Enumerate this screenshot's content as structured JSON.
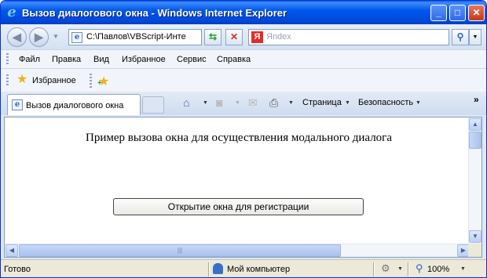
{
  "window": {
    "title": "Вызов диалогового окна - Windows Internet Explorer",
    "minimize_glyph": "_",
    "maximize_glyph": "□",
    "close_glyph": "✕"
  },
  "address_bar": {
    "url": "C:\\Павлов\\VBScript-Инте",
    "search_placeholder": "Яndex",
    "search_logo": "Я"
  },
  "menu": {
    "items": [
      "Файл",
      "Правка",
      "Вид",
      "Избранное",
      "Сервис",
      "Справка"
    ]
  },
  "favorites": {
    "label": "Избранное"
  },
  "tabs": {
    "active_label": "Вызов диалогового окна"
  },
  "command_bar": {
    "page_label": "Страница",
    "safety_label": "Безопасность",
    "overflow": "»"
  },
  "page": {
    "heading": "Пример вызова окна для осуществления модального диалога",
    "button_label": "Открытие окна для регистрации"
  },
  "status": {
    "text": "Готово",
    "zone": "Мой компьютер",
    "zoom": "100%"
  },
  "colors": {
    "titlebar": "#0058ee",
    "chrome": "#dfe8f5",
    "statusbar": "#ece9d8"
  }
}
